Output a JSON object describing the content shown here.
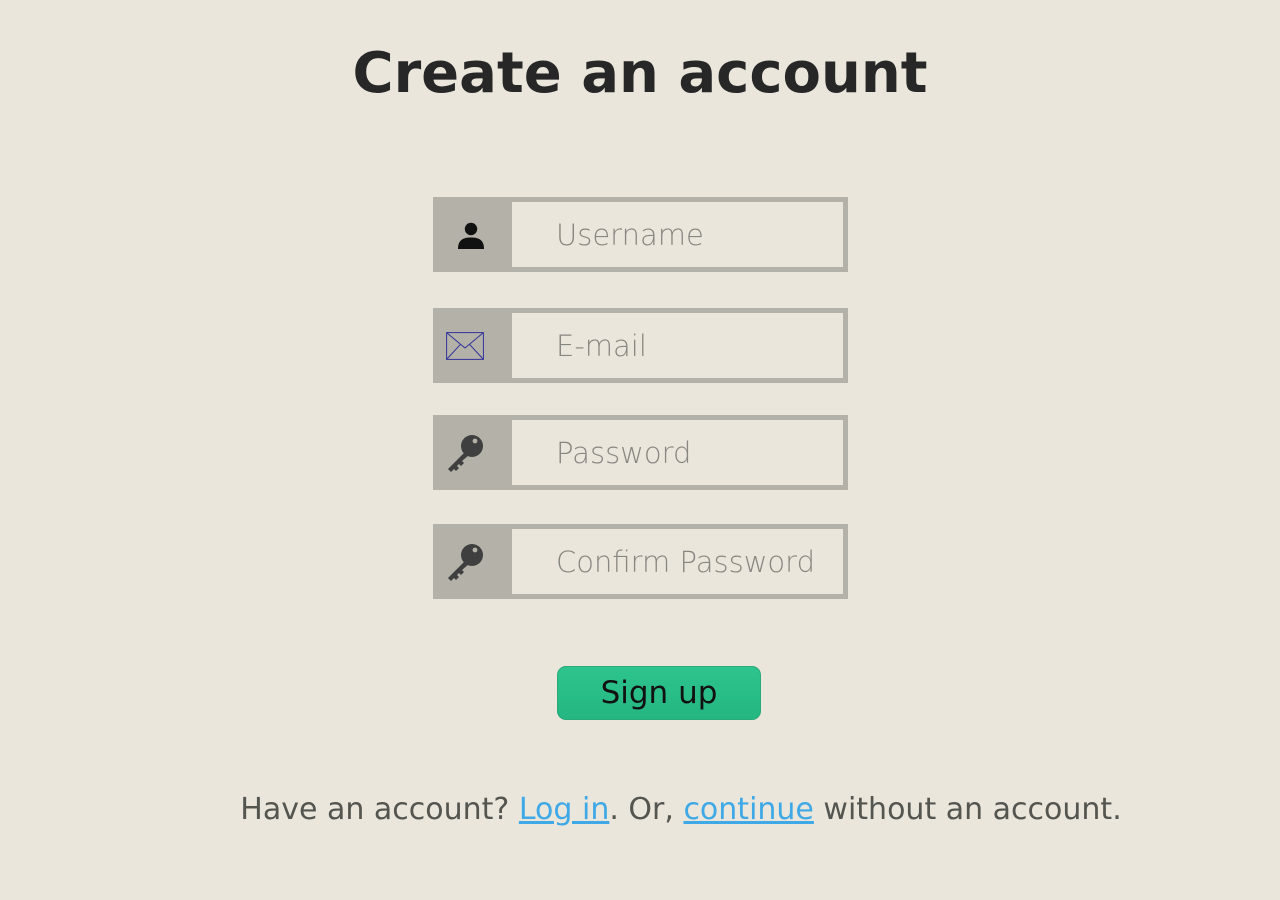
{
  "page": {
    "title": "Create an account"
  },
  "form": {
    "username": {
      "placeholder": "Username",
      "value": "",
      "icon": "user-icon"
    },
    "email": {
      "placeholder": "E-mail",
      "value": "",
      "icon": "envelope-icon"
    },
    "password": {
      "placeholder": "Password",
      "value": "",
      "icon": "key-icon"
    },
    "confirm_password": {
      "placeholder": "Confirm Password",
      "value": "",
      "icon": "key-icon"
    },
    "signup_label": "Sign up"
  },
  "footer": {
    "prefix": "Have an account? ",
    "login_link": "Log in",
    "middle": ". Or, ",
    "continue_link": "continue",
    "suffix": " without an account."
  },
  "colors": {
    "background": "#eae6db",
    "field_frame": "#b3b1a8",
    "button": "#2dc48d",
    "link": "#3ea9e6",
    "title": "#272727"
  }
}
